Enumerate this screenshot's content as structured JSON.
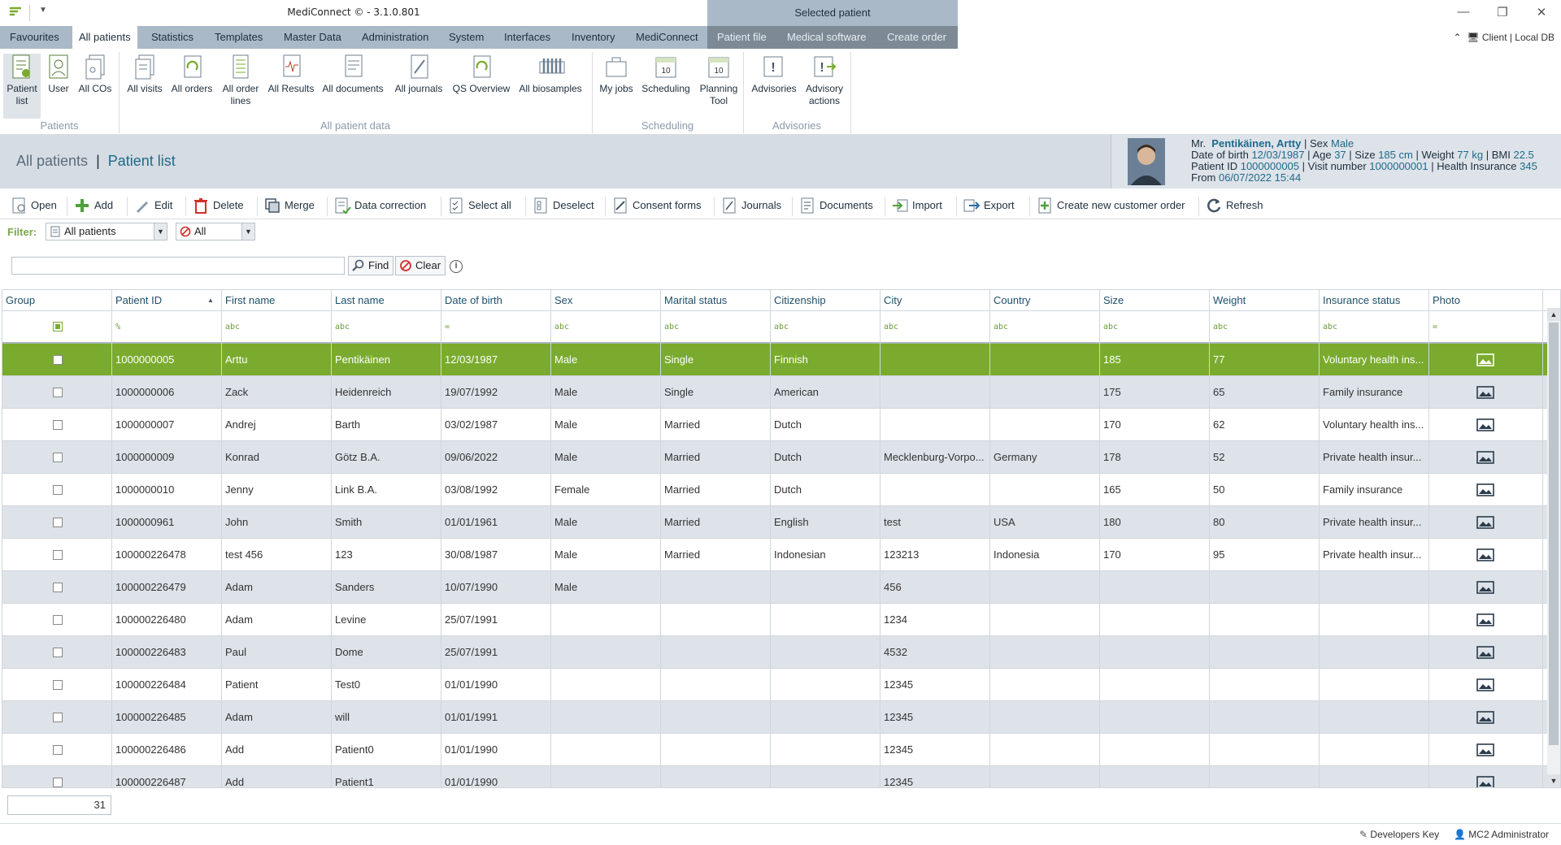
{
  "app": {
    "title": "MediConnect © - 3.1.0.801",
    "context_title": "Selected patient",
    "client_info": "Client | Local DB"
  },
  "menu": {
    "tabs": [
      "Favourites",
      "All patients",
      "Statistics",
      "Templates",
      "Master Data",
      "Administration",
      "System",
      "Interfaces",
      "Inventory",
      "MediConnect"
    ],
    "context_tabs": [
      "Patient file",
      "Medical software",
      "Create order"
    ]
  },
  "ribbon": {
    "buttons": [
      {
        "line1": "Patient",
        "line2": "list"
      },
      {
        "line1": "User",
        "line2": ""
      },
      {
        "line1": "All COs",
        "line2": ""
      },
      {
        "line1": "All visits",
        "line2": ""
      },
      {
        "line1": "All orders",
        "line2": ""
      },
      {
        "line1": "All order",
        "line2": "lines"
      },
      {
        "line1": "All Results",
        "line2": ""
      },
      {
        "line1": "All documents",
        "line2": ""
      },
      {
        "line1": "All journals",
        "line2": ""
      },
      {
        "line1": "QS Overview",
        "line2": ""
      },
      {
        "line1": "All biosamples",
        "line2": ""
      },
      {
        "line1": "My jobs",
        "line2": ""
      },
      {
        "line1": "Scheduling",
        "line2": ""
      },
      {
        "line1": "Planning",
        "line2": "Tool"
      },
      {
        "line1": "Advisories",
        "line2": ""
      },
      {
        "line1": "Advisory",
        "line2": "actions"
      }
    ],
    "groups": [
      "Patients",
      "All patient data",
      "Scheduling",
      "Advisories"
    ]
  },
  "breadcrumb": {
    "root": "All patients",
    "separator": "|",
    "current": "Patient list"
  },
  "patient_card": {
    "salutation": "Mr.",
    "name": "Pentikäinen, Artty",
    "sex_label": "| Sex",
    "sex": "Male",
    "dob_label": "Date of birth",
    "dob": "12/03/1987",
    "age_label": "| Age",
    "age": "37",
    "size_label": "| Size",
    "size": "185 cm",
    "weight_label": "| Weight",
    "weight": "77 kg",
    "bmi_label": "| BMI",
    "bmi": "22.5",
    "pid_label": "Patient ID",
    "pid": "1000000005",
    "visit_label": "| Visit number",
    "visit": "1000000001",
    "ins_label": "| Health Insurance",
    "ins": "345",
    "from_label": "From",
    "from": "06/07/2022 15:44"
  },
  "toolbar": [
    "Open",
    "Add",
    "Edit",
    "Delete",
    "Merge",
    "Data correction",
    "Select all",
    "Deselect",
    "Consent forms",
    "Journals",
    "Documents",
    "Import",
    "Export",
    "Create new customer order",
    "Refresh"
  ],
  "filter": {
    "label": "Filter:",
    "combo1": "All patients",
    "combo2": "All"
  },
  "search": {
    "value": "",
    "find_label": "Find",
    "clear_label": "Clear"
  },
  "grid": {
    "columns": [
      "Group",
      "Patient ID",
      "First name",
      "Last name",
      "Date of birth",
      "Sex",
      "Marital status",
      "Citizenship",
      "City",
      "Country",
      "Size",
      "Weight",
      "Insurance status",
      "Photo"
    ],
    "filter_icons": [
      "",
      "%",
      "abc",
      "abc",
      "=",
      "abc",
      "abc",
      "abc",
      "abc",
      "abc",
      "abc",
      "abc",
      "abc",
      "="
    ],
    "rows": [
      [
        "1000000005",
        "Arttu",
        "Pentikäinen",
        "12/03/1987",
        "Male",
        "Single",
        "Finnish",
        "",
        "",
        "185",
        "77",
        "Voluntary health ins..."
      ],
      [
        "1000000006",
        "Zack",
        "Heidenreich",
        "19/07/1992",
        "Male",
        "Single",
        "American",
        "",
        "",
        "175",
        "65",
        "Family insurance"
      ],
      [
        "1000000007",
        "Andrej",
        "Barth",
        "03/02/1987",
        "Male",
        "Married",
        "Dutch",
        "",
        "",
        "170",
        "62",
        "Voluntary health ins..."
      ],
      [
        "1000000009",
        "Konrad",
        "Götz B.A.",
        "09/06/2022",
        "Male",
        "Married",
        "Dutch",
        "Mecklenburg-Vorpo...",
        "Germany",
        "178",
        "52",
        "Private health insur..."
      ],
      [
        "1000000010",
        "Jenny",
        "Link B.A.",
        "03/08/1992",
        "Female",
        "Married",
        "Dutch",
        "",
        "",
        "165",
        "50",
        "Family insurance"
      ],
      [
        "1000000961",
        "John",
        "Smith",
        "01/01/1961",
        "Male",
        "Married",
        "English",
        "test",
        "USA",
        "180",
        "80",
        "Private health insur..."
      ],
      [
        "100000226478",
        "test 456",
        "123",
        "30/08/1987",
        "Male",
        "Married",
        "Indonesian",
        "123213",
        "Indonesia",
        "170",
        "95",
        "Private health insur..."
      ],
      [
        "100000226479",
        "Adam",
        "Sanders",
        "10/07/1990",
        "Male",
        "",
        "",
        "456",
        "",
        "",
        "",
        ""
      ],
      [
        "100000226480",
        "Adam",
        "Levine",
        "25/07/1991",
        "",
        "",
        "",
        "1234",
        "",
        "",
        "",
        ""
      ],
      [
        "100000226483",
        "Paul",
        "Dome",
        "25/07/1991",
        "",
        "",
        "",
        "4532",
        "",
        "",
        "",
        ""
      ],
      [
        "100000226484",
        "Patient",
        "Test0",
        "01/01/1990",
        "",
        "",
        "",
        "12345",
        "",
        "",
        "",
        ""
      ],
      [
        "100000226485",
        "Adam",
        "will",
        "01/01/1991",
        "",
        "",
        "",
        "12345",
        "",
        "",
        "",
        ""
      ],
      [
        "100000226486",
        "Add",
        "Patient0",
        "01/01/1990",
        "",
        "",
        "",
        "12345",
        "",
        "",
        "",
        ""
      ],
      [
        "100000226487",
        "Add",
        "Patient1",
        "01/01/1990",
        "",
        "",
        "",
        "12345",
        "",
        "",
        "",
        ""
      ]
    ],
    "selected_row": 0,
    "record_count": "31"
  },
  "status": {
    "left": "Developers Key",
    "right": "MC2 Administrator"
  },
  "colors": {
    "accent": "#7aab2e",
    "header_band": "#d5dce3",
    "tab_bar": "#aab9c7",
    "context_tabs": "#7d8a96",
    "link": "#1e6a8a"
  }
}
